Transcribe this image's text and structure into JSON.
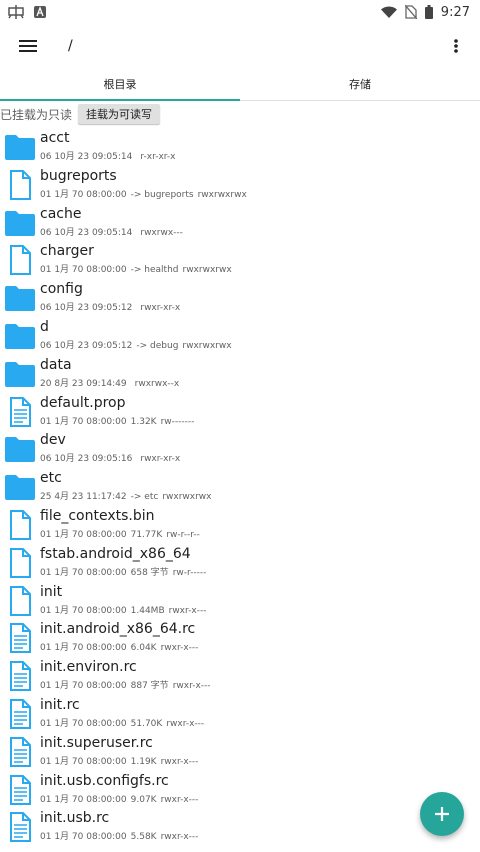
{
  "status_bar": {
    "time": "9:27",
    "left_icons": [
      "chip-icon",
      "a-badge-icon"
    ],
    "right_icons": [
      "wifi-icon",
      "no-sim-icon",
      "battery-icon"
    ]
  },
  "toolbar": {
    "path": "/"
  },
  "tabs": [
    {
      "label": "根目录",
      "active": true
    },
    {
      "label": "存储",
      "active": false
    }
  ],
  "mount": {
    "status": "已挂载为只读",
    "button": "挂载为可读写"
  },
  "colors": {
    "accent": "#26a69a",
    "folder": "#29a9f0",
    "file_outline": "#29a9f0"
  },
  "files": [
    {
      "name": "acct",
      "date": "06 10月 23 09:05:14",
      "link": "",
      "perms": "r-xr-xr-x",
      "icon": "folder-icon"
    },
    {
      "name": "bugreports",
      "date": "01 1月 70 08:00:00",
      "link": "-> bugreports",
      "perms": "rwxrwxrwx",
      "icon": "file-icon"
    },
    {
      "name": "cache",
      "date": "06 10月 23 09:05:14",
      "link": "",
      "perms": "rwxrwx---",
      "icon": "folder-icon"
    },
    {
      "name": "charger",
      "date": "01 1月 70 08:00:00",
      "link": "-> healthd",
      "perms": "rwxrwxrwx",
      "icon": "file-icon"
    },
    {
      "name": "config",
      "date": "06 10月 23 09:05:12",
      "link": "",
      "perms": "rwxr-xr-x",
      "icon": "folder-icon"
    },
    {
      "name": "d",
      "date": "06 10月 23 09:05:12",
      "link": "-> debug",
      "perms": "rwxrwxrwx",
      "icon": "folder-icon"
    },
    {
      "name": "data",
      "date": "20 8月 23 09:14:49",
      "link": "",
      "perms": "rwxrwx--x",
      "icon": "folder-icon"
    },
    {
      "name": "default.prop",
      "date": "01 1月 70 08:00:00",
      "link": "1.32K",
      "perms": "rw-------",
      "icon": "text-file-icon"
    },
    {
      "name": "dev",
      "date": "06 10月 23 09:05:16",
      "link": "",
      "perms": "rwxr-xr-x",
      "icon": "folder-icon"
    },
    {
      "name": "etc",
      "date": "25 4月 23 11:17:42",
      "link": "-> etc",
      "perms": "rwxrwxrwx",
      "icon": "folder-icon"
    },
    {
      "name": "file_contexts.bin",
      "date": "01 1月 70 08:00:00",
      "link": "71.77K",
      "perms": "rw-r--r--",
      "icon": "file-icon"
    },
    {
      "name": "fstab.android_x86_64",
      "date": "01 1月 70 08:00:00",
      "link": "658 字节",
      "perms": "rw-r-----",
      "icon": "file-icon"
    },
    {
      "name": "init",
      "date": "01 1月 70 08:00:00",
      "link": "1.44MB",
      "perms": "rwxr-x---",
      "icon": "file-icon"
    },
    {
      "name": "init.android_x86_64.rc",
      "date": "01 1月 70 08:00:00",
      "link": "6.04K",
      "perms": "rwxr-x---",
      "icon": "text-file-icon"
    },
    {
      "name": "init.environ.rc",
      "date": "01 1月 70 08:00:00",
      "link": "887 字节",
      "perms": "rwxr-x---",
      "icon": "text-file-icon"
    },
    {
      "name": "init.rc",
      "date": "01 1月 70 08:00:00",
      "link": "51.70K",
      "perms": "rwxr-x---",
      "icon": "text-file-icon"
    },
    {
      "name": "init.superuser.rc",
      "date": "01 1月 70 08:00:00",
      "link": "1.19K",
      "perms": "rwxr-x---",
      "icon": "text-file-icon"
    },
    {
      "name": "init.usb.configfs.rc",
      "date": "01 1月 70 08:00:00",
      "link": "9.07K",
      "perms": "rwxr-x---",
      "icon": "text-file-icon"
    },
    {
      "name": "init.usb.rc",
      "date": "01 1月 70 08:00:00",
      "link": "5.58K",
      "perms": "rwxr-x---",
      "icon": "text-file-icon"
    }
  ],
  "fab": {
    "icon": "plus-icon"
  }
}
